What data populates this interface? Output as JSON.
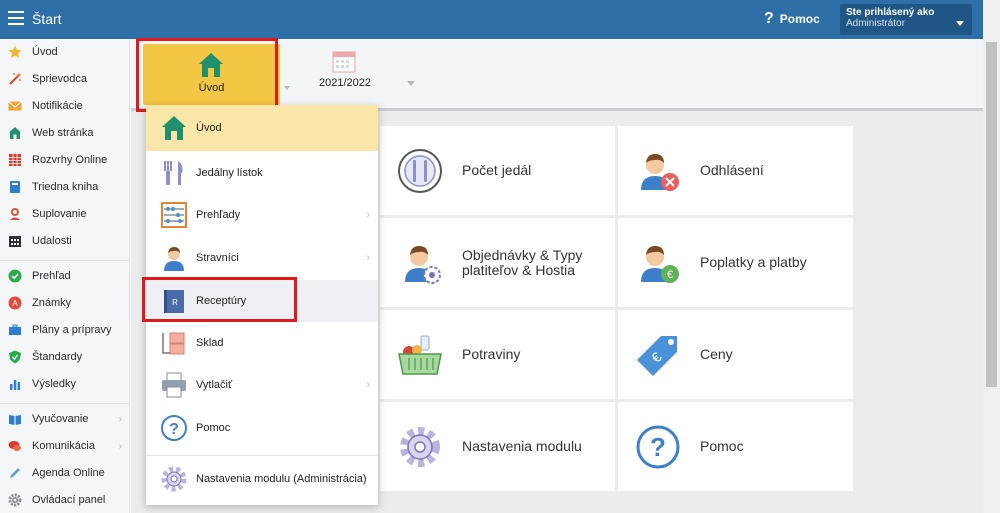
{
  "app": {
    "title": "Štart"
  },
  "topbar": {
    "help_label": "Pomoc",
    "user_line1": "Ste prihlásený ako",
    "user_line2": "Administrátor"
  },
  "sidebar": {
    "items": [
      {
        "label": "Úvod",
        "icon": "star-icon"
      },
      {
        "label": "Sprievodca",
        "icon": "wand-icon"
      },
      {
        "label": "Notifikácie",
        "icon": "envelope-icon"
      },
      {
        "label": "Web stránka",
        "icon": "home-icon"
      },
      {
        "label": "Rozvrhy Online",
        "icon": "timetable-icon"
      },
      {
        "label": "Triedna kniha",
        "icon": "book-icon"
      },
      {
        "label": "Suplovanie",
        "icon": "person-icon"
      },
      {
        "label": "Udalosti",
        "icon": "calendar-icon"
      },
      {
        "label": "Prehľad",
        "icon": "check-icon"
      },
      {
        "label": "Známky",
        "icon": "grade-icon"
      },
      {
        "label": "Plány a prípravy",
        "icon": "briefcase-icon"
      },
      {
        "label": "Štandardy",
        "icon": "shield-check-icon"
      },
      {
        "label": "Výsledky",
        "icon": "bar-chart-icon"
      },
      {
        "label": "Vyučovanie",
        "icon": "open-book-icon"
      },
      {
        "label": "Komunikácia",
        "icon": "chat-icon"
      },
      {
        "label": "Agenda Online",
        "icon": "pen-icon"
      },
      {
        "label": "Ovládací panel",
        "icon": "gear-icon"
      }
    ]
  },
  "modules": {
    "uvod_label": "Úvod",
    "year_label": "2021/2022"
  },
  "dropdown": {
    "items": [
      {
        "label": "Úvod",
        "icon": "home-icon"
      },
      {
        "label": "Jedálny lístok",
        "icon": "cutlery-icon"
      },
      {
        "label": "Prehľady",
        "icon": "abacus-icon"
      },
      {
        "label": "Stravníci",
        "icon": "person-icon"
      },
      {
        "label": "Receptúry",
        "icon": "recipe-book-icon"
      },
      {
        "label": "Sklad",
        "icon": "boxes-icon"
      },
      {
        "label": "Vytlačiť",
        "icon": "printer-icon"
      },
      {
        "label": "Pomoc",
        "icon": "help-icon"
      },
      {
        "label": "Nastavenia modulu (Administrácia)",
        "icon": "gear-icon"
      }
    ]
  },
  "tiles": {
    "pocet_jedal": "Počet jedál",
    "odhlaseni": "Odhlásení",
    "objednavky": "Objednávky & Typy platiteľov & Hostia",
    "poplatky": "Poplatky a platby",
    "potraviny": "Potraviny",
    "ceny": "Ceny",
    "nastavenia": "Nastavenia modulu",
    "pomoc": "Pomoc"
  },
  "colors": {
    "topbar": "#2f6fa8",
    "accent_yellow": "#f2c744",
    "highlight_red": "#e0191f"
  }
}
